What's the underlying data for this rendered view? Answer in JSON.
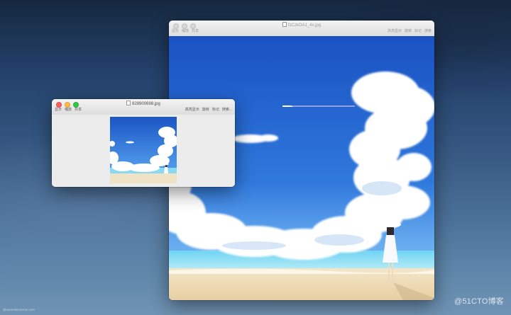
{
  "windows": {
    "large": {
      "title": "fzCzkOA1_4x.jpg",
      "toolbar_left": [
        "显示",
        "缩放",
        "共享"
      ],
      "toolbar_right": [
        "高亮显示",
        "旋转",
        "标记",
        "搜索"
      ]
    },
    "small": {
      "title": "828900698.jpg",
      "toolbar_left": [
        "显示",
        "缩放",
        "共享"
      ],
      "toolbar_right": [
        "高亮显示",
        "旋转",
        "标记",
        "搜索..."
      ]
    }
  },
  "watermarks": {
    "bottom_left": "@www.MacZoom.com",
    "bottom_right": "@51CTO博客"
  },
  "colors": {
    "traffic_red": "#fc605c",
    "traffic_yellow": "#fdbc40",
    "traffic_green": "#34c84a",
    "sky_blue": "#1f63c9"
  }
}
